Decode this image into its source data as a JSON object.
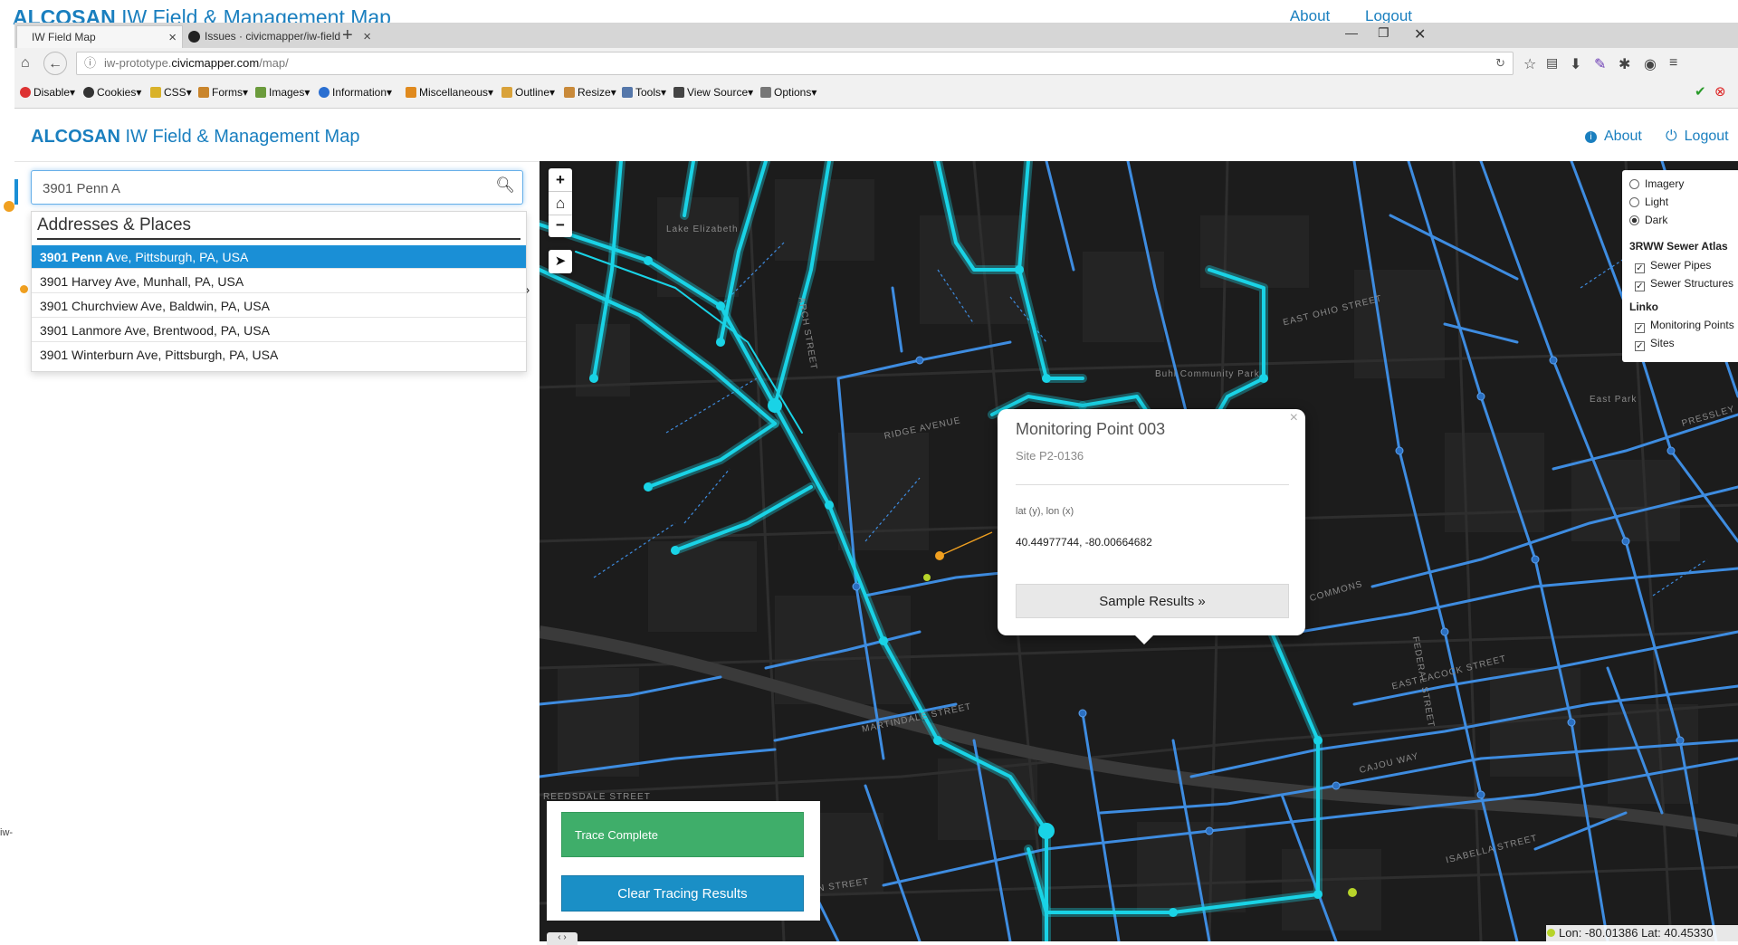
{
  "ghost_header": {
    "brand": "ALCOSAN",
    "title": "IW Field & Management Map",
    "about": "About",
    "logout": "Logout"
  },
  "browser": {
    "tabs": [
      {
        "label": "IW Field Map",
        "active": true
      },
      {
        "label": "Issues · civicmapper/iw-field",
        "active": false
      }
    ],
    "new_tab": "+",
    "url_domain_prefix": "iw-prototype.",
    "url_domain": "civicmapper.com",
    "url_path": "/map/",
    "toolbar_items": [
      "Disable",
      "Cookies",
      "CSS",
      "Forms",
      "Images",
      "Information",
      "Miscellaneous",
      "Outline",
      "Resize",
      "Tools",
      "View Source",
      "Options"
    ]
  },
  "app": {
    "brand": "ALCOSAN",
    "title": "IW Field & Management Map",
    "about": "About",
    "logout": "Logout"
  },
  "search": {
    "value": "3901 Penn A",
    "dropdown_header": "Addresses & Places",
    "results": [
      {
        "match": "3901 Penn A",
        "rest": "ve, Pittsburgh, PA, USA",
        "selected": true
      },
      {
        "match": "",
        "rest": "3901 Harvey Ave, Munhall, PA, USA",
        "selected": false
      },
      {
        "match": "",
        "rest": "3901 Churchview Ave, Baldwin, PA, USA",
        "selected": false
      },
      {
        "match": "",
        "rest": "3901 Lanmore Ave, Brentwood, PA, USA",
        "selected": false
      },
      {
        "match": "",
        "rest": "3901 Winterburn Ave, Pittsburgh, PA, USA",
        "selected": false
      }
    ]
  },
  "edge_text": "iw-",
  "map": {
    "zoom_in": "+",
    "home": "⌂",
    "zoom_out": "−",
    "street_labels": [
      "Lake Elizabeth",
      "ARCH STREET",
      "RIDGE AVENUE",
      "EAST OHIO STREET",
      "Buhl Community Park",
      "East Park",
      "MARTINDALE STREET",
      "REEDSDALE STREET",
      "WEST GENERAL ROBINSON STREET",
      "EAST LACOCK STREET",
      "COMMONS",
      "CAJOU WAY",
      "ISABELLA STREET",
      "FEDERAL STREET",
      "PRESSLEY STREET"
    ],
    "colors": {
      "background": "#1c1c1c",
      "traced": "#19d3e6",
      "pipes": "#3e8ce0"
    }
  },
  "layers": {
    "basemaps": [
      {
        "label": "Imagery",
        "on": false
      },
      {
        "label": "Light",
        "on": false
      },
      {
        "label": "Dark",
        "on": true
      }
    ],
    "groups": [
      {
        "name": "3RWW Sewer Atlas",
        "items": [
          {
            "label": "Sewer Pipes",
            "checked": true
          },
          {
            "label": "Sewer Structures",
            "checked": true
          }
        ]
      },
      {
        "name": "Linko",
        "items": [
          {
            "label": "Monitoring Points",
            "checked": true
          },
          {
            "label": "Sites",
            "checked": true
          }
        ]
      }
    ]
  },
  "popup": {
    "close": "×",
    "title": "Monitoring Point 003",
    "subtitle": "Site P2-0136",
    "coord_label": "lat (y), lon (x)",
    "coord_value": "40.44977744, -80.00664682",
    "button": "Sample Results »"
  },
  "trace": {
    "status": "Trace Complete",
    "clear": "Clear Tracing Results"
  },
  "collapse": "‹ ›",
  "coords": "Lon: -80.01386 Lat: 40.45330"
}
